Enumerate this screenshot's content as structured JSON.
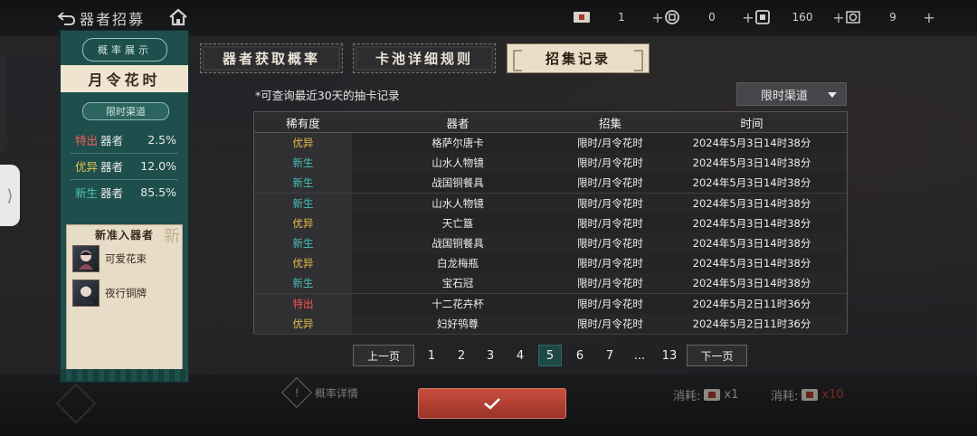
{
  "header": {
    "title": "器者招募",
    "resources": [
      {
        "icon": "envelope-icon",
        "value": "1"
      },
      {
        "icon": "coin-icon",
        "value": "0"
      },
      {
        "icon": "ticket-icon",
        "value": "160"
      },
      {
        "icon": "gem-icon",
        "value": "9"
      }
    ],
    "plus": "+"
  },
  "left_panel": {
    "tag": "概率展示",
    "pool_name": "月令花时",
    "channel": "限时渠道",
    "rates": [
      {
        "tier": "特出",
        "kind": "器者",
        "pct": "2.5%"
      },
      {
        "tier": "优异",
        "kind": "器者",
        "pct": "12.0%"
      },
      {
        "tier": "新生",
        "kind": "器者",
        "pct": "85.5%"
      }
    ],
    "new_title": "新准入器者",
    "new_stamp": "新",
    "new_items": [
      {
        "name": "可爱花束"
      },
      {
        "name": "夜行铜牌"
      }
    ]
  },
  "tabs": [
    {
      "label": "器者获取概率",
      "active": false
    },
    {
      "label": "卡池详细规则",
      "active": false
    },
    {
      "label": "招集记录",
      "active": true
    }
  ],
  "note": "*可查询最近30天的抽卡记录",
  "filter": {
    "selected": "限时渠道"
  },
  "table": {
    "headers": [
      "稀有度",
      "器者",
      "招集",
      "时间"
    ],
    "rows": [
      {
        "rarity": "优异",
        "name": "格萨尔唐卡",
        "pool": "限时/月令花时",
        "time": "2024年5月3日14时38分"
      },
      {
        "rarity": "新生",
        "name": "山水人物镜",
        "pool": "限时/月令花时",
        "time": "2024年5月3日14时38分"
      },
      {
        "rarity": "新生",
        "name": "战国铜餐具",
        "pool": "限时/月令花时",
        "time": "2024年5月3日14时38分"
      },
      {
        "rarity": "新生",
        "name": "山水人物镜",
        "pool": "限时/月令花时",
        "time": "2024年5月3日14时38分"
      },
      {
        "rarity": "优异",
        "name": "天亡簋",
        "pool": "限时/月令花时",
        "time": "2024年5月3日14时38分"
      },
      {
        "rarity": "新生",
        "name": "战国铜餐具",
        "pool": "限时/月令花时",
        "time": "2024年5月3日14时38分"
      },
      {
        "rarity": "优异",
        "name": "白龙梅瓶",
        "pool": "限时/月令花时",
        "time": "2024年5月3日14时38分"
      },
      {
        "rarity": "新生",
        "name": "宝石冠",
        "pool": "限时/月令花时",
        "time": "2024年5月3日14时38分"
      },
      {
        "rarity": "特出",
        "name": "十二花卉杯",
        "pool": "限时/月令花时",
        "time": "2024年5月2日11时36分"
      },
      {
        "rarity": "优异",
        "name": "妇好鸮尊",
        "pool": "限时/月令花时",
        "time": "2024年5月2日11时36分"
      }
    ]
  },
  "pagination": {
    "prev": "上一页",
    "next": "下一页",
    "pages": [
      "1",
      "2",
      "3",
      "4",
      "5",
      "6",
      "7",
      "...",
      "13"
    ],
    "current": "5"
  },
  "bottom": {
    "prob_detail": "概率详情",
    "cost_label": "消耗:",
    "cost1": "x1",
    "cost2": "x10"
  },
  "colors": {
    "special": "#ff5050",
    "excellent": "#e9c04a",
    "novice": "#47c0b6",
    "accent_teal": "#1f4f4c",
    "confirm_red": "#b5402f"
  }
}
